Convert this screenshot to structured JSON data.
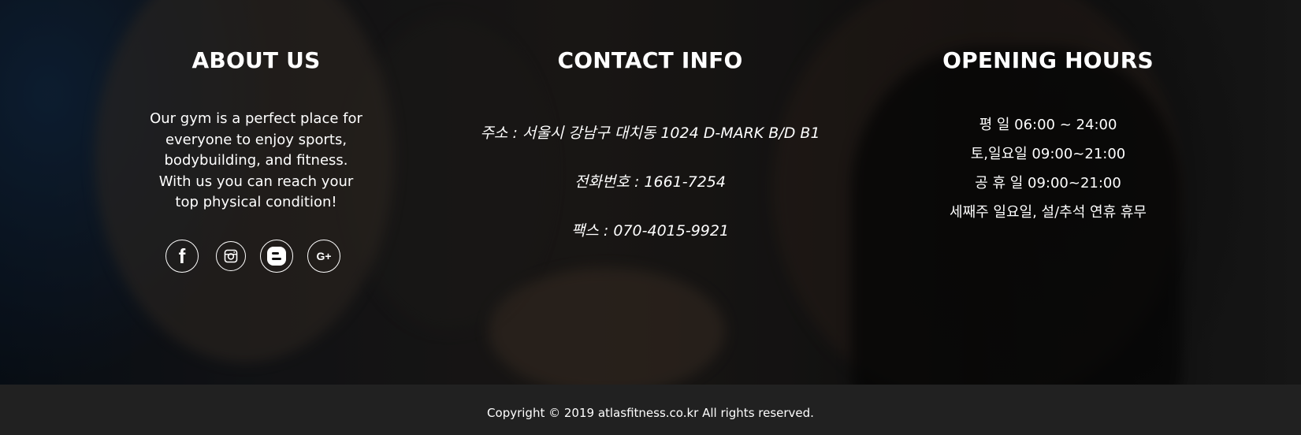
{
  "about": {
    "title": "ABOUT US",
    "text": "Our gym is a perfect place for everyone to enjoy sports, bodybuilding, and fitness. With us you can reach your top physical condition!",
    "social": [
      {
        "icon": "facebook-icon",
        "glyph": "f"
      },
      {
        "icon": "instagram-icon"
      },
      {
        "icon": "blogger-icon"
      },
      {
        "icon": "google-plus-icon",
        "glyph": "G+"
      }
    ]
  },
  "contact": {
    "title": "CONTACT INFO",
    "address": "주소 : 서울시 강남구 대치동 1024 D-MARK B/D B1",
    "phone": "전화번호 : 1661-7254",
    "fax": "팩스 : 070-4015-9921"
  },
  "hours": {
    "title": "OPENING HOURS",
    "weekday": "평 일 06:00 ~ 24:00",
    "weekend": "토,일요일 09:00~21:00",
    "holiday": "공 휴 일 09:00~21:00",
    "closed": "세째주 일요일, 설/추석 연휴 휴무"
  },
  "footer": {
    "copyright": "Copyright © 2019 atlasfitness.co.kr All rights reserved."
  },
  "colors": {
    "footer_bg": "#212121",
    "text": "#ffffff"
  }
}
